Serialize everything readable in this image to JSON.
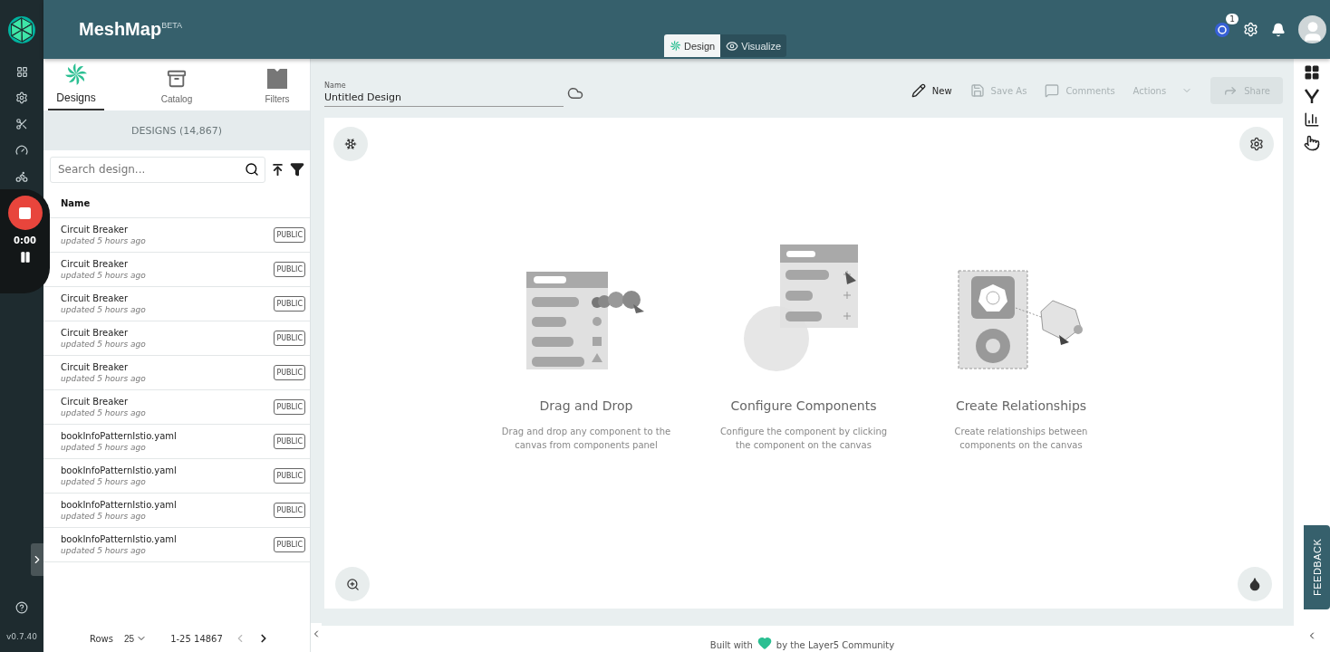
{
  "app": {
    "title": "MeshMap",
    "badge": "BETA",
    "version": "v0.7.40"
  },
  "recorder": {
    "time": "0:00"
  },
  "mode_tabs": [
    {
      "label": "Design",
      "selected": true
    },
    {
      "label": "Visualize",
      "selected": false
    }
  ],
  "header": {
    "notification_count": "1"
  },
  "panel_tabs": [
    {
      "label": "Designs",
      "selected": true
    },
    {
      "label": "Catalog",
      "selected": false
    },
    {
      "label": "Filters",
      "selected": false
    }
  ],
  "designs_heading": "DESIGNS (14,867)",
  "search": {
    "placeholder": "Search design..."
  },
  "list": {
    "column": "Name",
    "rows": [
      {
        "name": "Circuit Breaker",
        "updated": "updated 5 hours ago",
        "badge": "PUBLIC"
      },
      {
        "name": "Circuit Breaker",
        "updated": "updated 5 hours ago",
        "badge": "PUBLIC"
      },
      {
        "name": "Circuit Breaker",
        "updated": "updated 5 hours ago",
        "badge": "PUBLIC"
      },
      {
        "name": "Circuit Breaker",
        "updated": "updated 5 hours ago",
        "badge": "PUBLIC"
      },
      {
        "name": "Circuit Breaker",
        "updated": "updated 5 hours ago",
        "badge": "PUBLIC"
      },
      {
        "name": "Circuit Breaker",
        "updated": "updated 5 hours ago",
        "badge": "PUBLIC"
      },
      {
        "name": "bookInfoPatternIstio.yaml",
        "updated": "updated 5 hours ago",
        "badge": "PUBLIC"
      },
      {
        "name": "bookInfoPatternIstio.yaml",
        "updated": "updated 5 hours ago",
        "badge": "PUBLIC"
      },
      {
        "name": "bookInfoPatternIstio.yaml",
        "updated": "updated 5 hours ago",
        "badge": "PUBLIC"
      },
      {
        "name": "bookInfoPatternIstio.yaml",
        "updated": "updated 5 hours ago",
        "badge": "PUBLIC"
      }
    ]
  },
  "pagination": {
    "rows_label": "Rows",
    "rows_value": "25",
    "range": "1-25 14867"
  },
  "design_name": {
    "label": "Name",
    "value": "Untitled Design"
  },
  "actions": [
    {
      "kind": "new",
      "label": "New",
      "disabled": false
    },
    {
      "kind": "save",
      "label": "Save As",
      "disabled": true
    },
    {
      "kind": "comments",
      "label": "Comments",
      "disabled": true
    },
    {
      "kind": "menu",
      "label": "Actions",
      "disabled": true
    },
    {
      "kind": "share",
      "label": "Share",
      "disabled": true
    }
  ],
  "cards": [
    {
      "kind": "drag",
      "title": "Drag and Drop",
      "text": "Drag and drop any component to the canvas from components panel"
    },
    {
      "kind": "configure",
      "title": "Configure Components",
      "text": "Configure the component by clicking the component on the canvas"
    },
    {
      "kind": "relate",
      "title": "Create Relationships",
      "text": "Create relationships between components on the canvas"
    }
  ],
  "footer": {
    "before": "Built with",
    "after": "by the Layer5 Community"
  },
  "feedback": "FEEDBACK"
}
